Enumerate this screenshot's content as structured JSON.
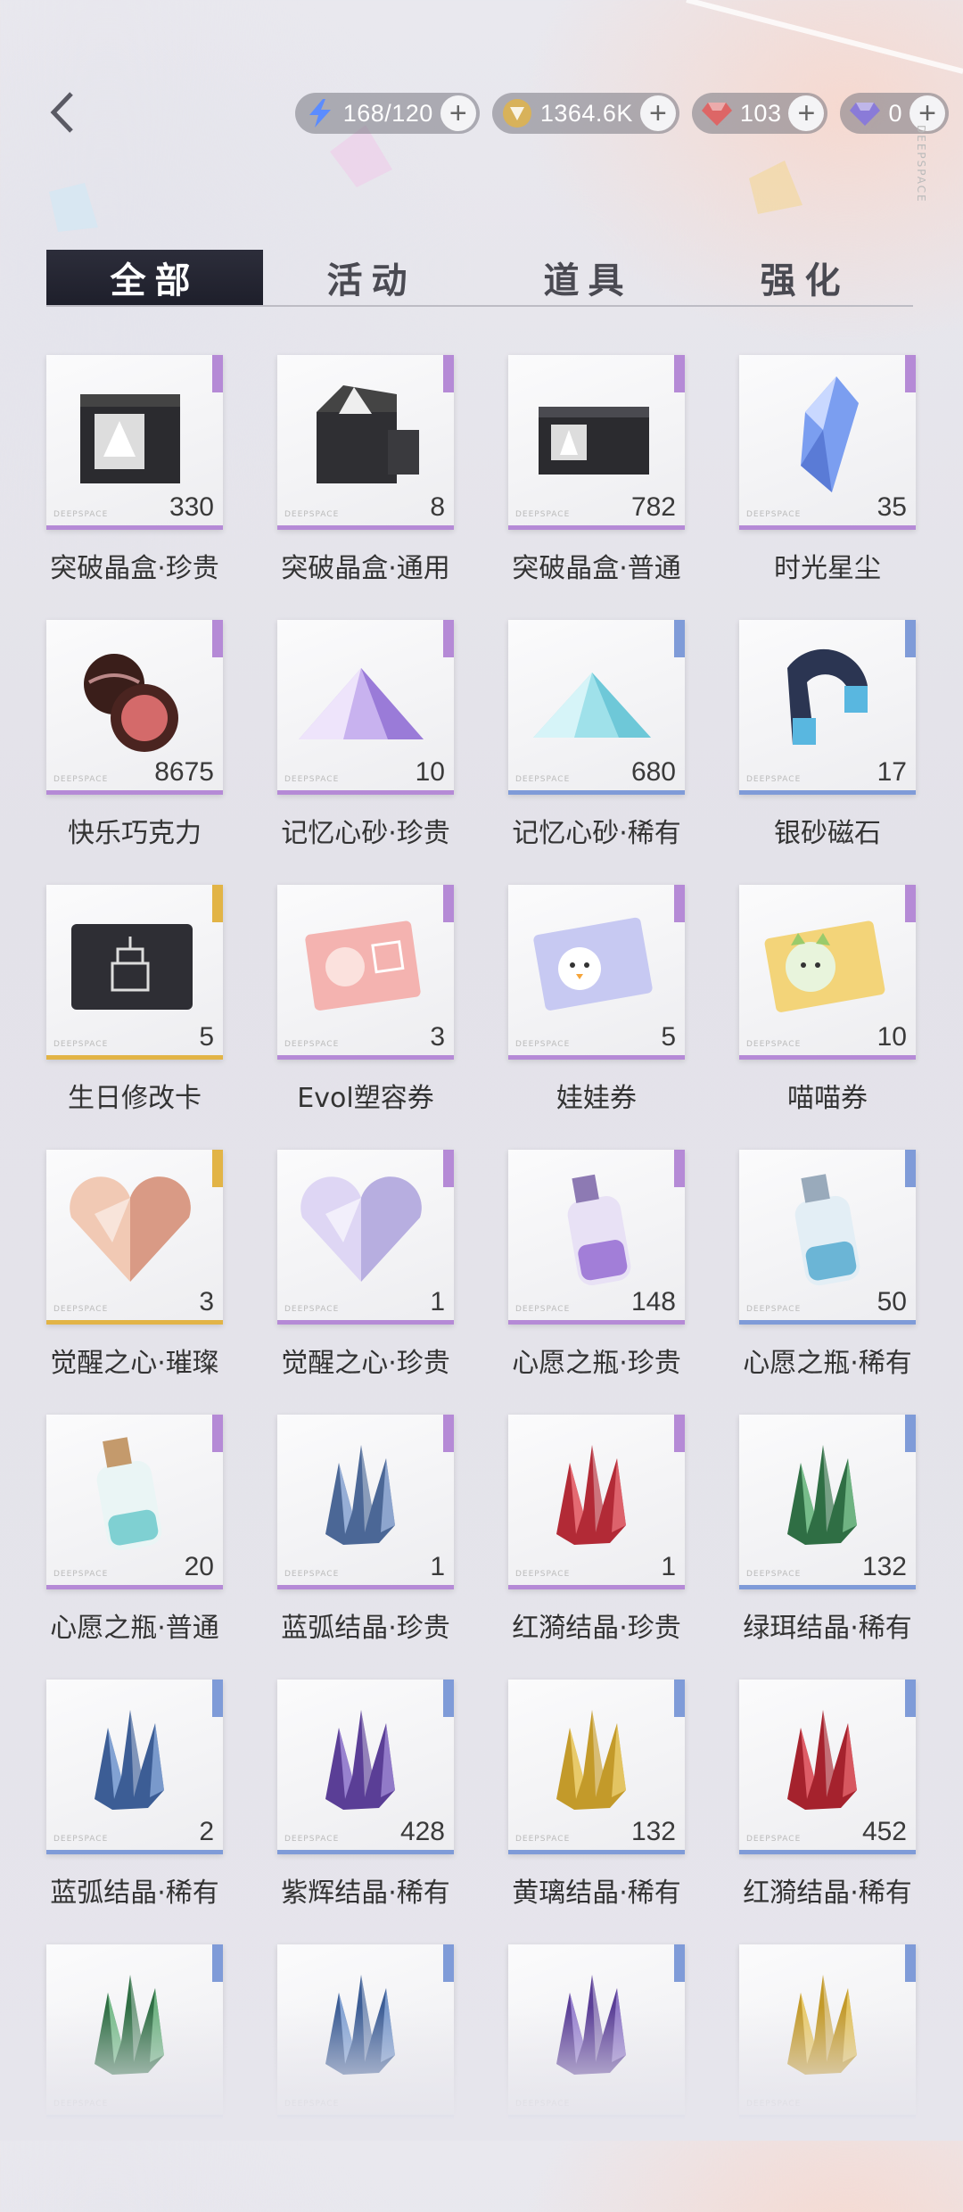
{
  "header": {
    "back_label": "back",
    "brand_vertical": "DEEPSPACE",
    "resources": [
      {
        "icon": "stamina-bolt-icon",
        "value": "168/120",
        "color": "#5b8cff"
      },
      {
        "icon": "gold-coin-icon",
        "value": "1364.6K",
        "color": "#d8b25a"
      },
      {
        "icon": "red-diamond-icon",
        "value": "103",
        "color": "#d66"
      },
      {
        "icon": "purple-diamond-icon",
        "value": "0",
        "color": "#8a7bd8"
      }
    ]
  },
  "tabs": [
    {
      "label": "全部",
      "active": true
    },
    {
      "label": "活动",
      "active": false
    },
    {
      "label": "道具",
      "active": false
    },
    {
      "label": "强化",
      "active": false
    }
  ],
  "card_brand": "DEEPSPACE",
  "items": [
    {
      "name": "突破晶盒·珍贵",
      "count": "330",
      "rarity": "#b58ad6",
      "art": "box-dark"
    },
    {
      "name": "突破晶盒·通用",
      "count": "8",
      "rarity": "#b58ad6",
      "art": "box-open"
    },
    {
      "name": "突破晶盒·普通",
      "count": "782",
      "rarity": "#b58ad6",
      "art": "box-flat"
    },
    {
      "name": "时光星尘",
      "count": "35",
      "rarity": "#b58ad6",
      "art": "crystal-blue"
    },
    {
      "name": "快乐巧克力",
      "count": "8675",
      "rarity": "#b58ad6",
      "art": "chocolate"
    },
    {
      "name": "记忆心砂·珍贵",
      "count": "10",
      "rarity": "#b58ad6",
      "art": "sand-purple"
    },
    {
      "name": "记忆心砂·稀有",
      "count": "680",
      "rarity": "#7f9bd8",
      "art": "sand-cyan"
    },
    {
      "name": "银砂磁石",
      "count": "17",
      "rarity": "#7f9bd8",
      "art": "magnet"
    },
    {
      "name": "生日修改卡",
      "count": "5",
      "rarity": "#e2b446",
      "art": "card-cake"
    },
    {
      "name": "Evol塑容券",
      "count": "3",
      "rarity": "#b58ad6",
      "art": "ticket-pink"
    },
    {
      "name": "娃娃券",
      "count": "5",
      "rarity": "#b58ad6",
      "art": "ticket-doll"
    },
    {
      "name": "喵喵券",
      "count": "10",
      "rarity": "#b58ad6",
      "art": "ticket-cat"
    },
    {
      "name": "觉醒之心·璀璨",
      "count": "3",
      "rarity": "#e2b446",
      "art": "heart-gold"
    },
    {
      "name": "觉醒之心·珍贵",
      "count": "1",
      "rarity": "#b58ad6",
      "art": "heart-lilac"
    },
    {
      "name": "心愿之瓶·珍贵",
      "count": "148",
      "rarity": "#b58ad6",
      "art": "bottle-purple"
    },
    {
      "name": "心愿之瓶·稀有",
      "count": "50",
      "rarity": "#7f9bd8",
      "art": "bottle-blue"
    },
    {
      "name": "心愿之瓶·普通",
      "count": "20",
      "rarity": "#b58ad6",
      "art": "bottle-teal"
    },
    {
      "name": "蓝弧结晶·珍贵",
      "count": "1",
      "rarity": "#b58ad6",
      "art": "shard-blue-big"
    },
    {
      "name": "红漪结晶·珍贵",
      "count": "1",
      "rarity": "#b58ad6",
      "art": "shard-red-big"
    },
    {
      "name": "绿珥结晶·稀有",
      "count": "132",
      "rarity": "#7f9bd8",
      "art": "shard-green"
    },
    {
      "name": "蓝弧结晶·稀有",
      "count": "2",
      "rarity": "#7f9bd8",
      "art": "shard-blue"
    },
    {
      "name": "紫辉结晶·稀有",
      "count": "428",
      "rarity": "#7f9bd8",
      "art": "shard-purple"
    },
    {
      "name": "黄璃结晶·稀有",
      "count": "132",
      "rarity": "#7f9bd8",
      "art": "shard-gold"
    },
    {
      "name": "红漪结晶·稀有",
      "count": "452",
      "rarity": "#7f9bd8",
      "art": "shard-red"
    },
    {
      "name": "",
      "count": "",
      "rarity": "#7f9bd8",
      "art": "shard-green"
    },
    {
      "name": "",
      "count": "",
      "rarity": "#7f9bd8",
      "art": "shard-blue"
    },
    {
      "name": "",
      "count": "",
      "rarity": "#7f9bd8",
      "art": "shard-purple"
    },
    {
      "name": "",
      "count": "",
      "rarity": "#7f9bd8",
      "art": "shard-gold"
    }
  ]
}
